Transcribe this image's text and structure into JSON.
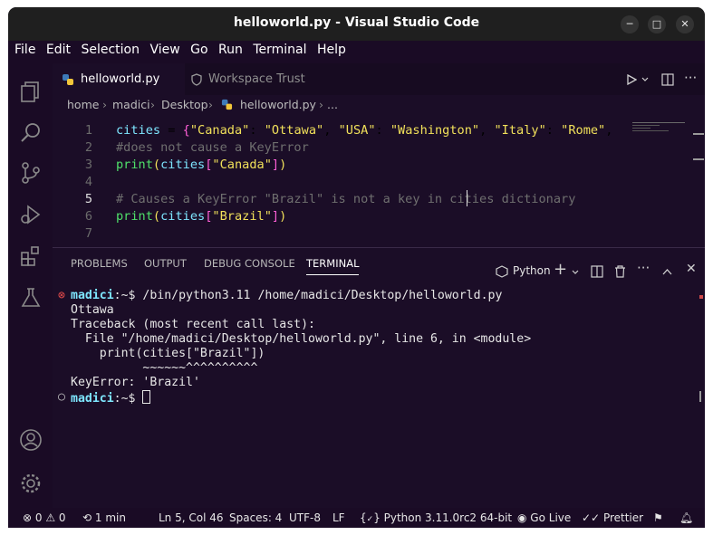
{
  "window": {
    "title": "helloworld.py - Visual Studio Code"
  },
  "menu": [
    "File",
    "Edit",
    "Selection",
    "View",
    "Go",
    "Run",
    "Terminal",
    "Help"
  ],
  "tabs": [
    {
      "label": "helloworld.py"
    },
    {
      "label": "Workspace Trust"
    }
  ],
  "breadcrumb": [
    "home",
    "madici",
    "Desktop",
    "helloworld.py",
    "..."
  ],
  "editor": {
    "line_numbers": [
      "1",
      "2",
      "3",
      "4",
      "5",
      "6",
      "7"
    ],
    "lines": [
      [
        [
          "id",
          "cities"
        ],
        [
          "p",
          " = "
        ],
        [
          "punc",
          "{"
        ],
        [
          "str",
          "\"Canada\""
        ],
        [
          "p",
          ": "
        ],
        [
          "str",
          "\"Ottawa\""
        ],
        [
          "p",
          ", "
        ],
        [
          "str",
          "\"USA\""
        ],
        [
          "p",
          ": "
        ],
        [
          "str",
          "\"Washington\""
        ],
        [
          "p",
          ", "
        ],
        [
          "str",
          "\"Italy\""
        ],
        [
          "p",
          ": "
        ],
        [
          "str",
          "\"Rome\""
        ],
        [
          "p",
          ","
        ]
      ],
      [
        [
          "cmt",
          "#does not cause a KeyError"
        ]
      ],
      [
        [
          "fn",
          "print"
        ],
        [
          "br",
          "("
        ],
        [
          "id",
          "cities"
        ],
        [
          "punc",
          "["
        ],
        [
          "str",
          "\"Canada\""
        ],
        [
          "punc",
          "]"
        ],
        [
          "br",
          ")"
        ]
      ],
      [],
      [
        [
          "cmt",
          "# Causes a KeyError \"Brazil\" is not a key in cities dictionary"
        ]
      ],
      [
        [
          "fn",
          "print"
        ],
        [
          "br",
          "("
        ],
        [
          "id",
          "cities"
        ],
        [
          "punc",
          "["
        ],
        [
          "str",
          "\"Brazil\""
        ],
        [
          "punc",
          "]"
        ],
        [
          "br",
          ")"
        ]
      ],
      []
    ]
  },
  "panel": {
    "tabs": [
      "PROBLEMS",
      "OUTPUT",
      "DEBUG CONSOLE",
      "TERMINAL"
    ],
    "active_tab": "TERMINAL",
    "terminal_kind": "Python"
  },
  "terminal": {
    "cmd": "/bin/python3.11 /home/madici/Desktop/helloworld.py",
    "prompt_user": "madici",
    "prompt_rest": ":~$ ",
    "output": [
      "Ottawa",
      "Traceback (most recent call last):",
      "  File \"/home/madici/Desktop/helloworld.py\", line 6, in <module>",
      "    print(cities[\"Brazil\"])",
      "          ~~~~~~^^^^^^^^^^",
      "KeyError: 'Brazil'"
    ]
  },
  "status": {
    "problems": "0",
    "warnings": "0",
    "time": "1 min",
    "cursor": "Ln 5, Col 46",
    "spaces": "Spaces: 4",
    "encoding": "UTF-8",
    "eol": "LF",
    "language": "Python",
    "interpreter": "3.11.0rc2 64-bit",
    "golive": "Go Live",
    "prettier": "Prettier"
  }
}
